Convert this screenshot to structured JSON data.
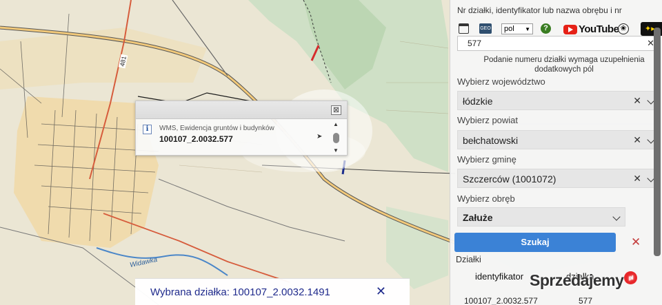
{
  "map": {
    "road_number": "481",
    "place_name": "Widawka"
  },
  "popup": {
    "layer_name": "WMS, Ewidencja gruntów i budynków",
    "parcel_id": "100107_2.0032.577",
    "close_symbol": "⊠",
    "info_symbol": "i"
  },
  "selected_bar": {
    "text": "Wybrana działka: 100107_2.0032.1491",
    "close_symbol": "✕"
  },
  "panel": {
    "top_text": "Nr działki, identyfikator lub nazwa obrębu i nr",
    "toolbar": {
      "geo_label": "GEO",
      "language": "pol",
      "help": "?",
      "youtube": "YouTube",
      "back_symbol": "✦▸"
    },
    "search_value": "577",
    "search_clear": "✕",
    "hint": "Podanie numeru działki wymaga uzupełnienia dodatkowych pól",
    "voivodeship": {
      "label": "Wybierz województwo",
      "value": "łódzkie"
    },
    "county": {
      "label": "Wybierz powiat",
      "value": "bełchatowski"
    },
    "commune": {
      "label": "Wybierz gminę",
      "value": "Szczerców (1001072)"
    },
    "precinct": {
      "label": "Wybierz obręb",
      "value": "Załuże"
    },
    "clear_symbol": "✕",
    "search_button": "Szukaj",
    "cancel_symbol": "✕",
    "results_label": "Działki",
    "table": {
      "headers": [
        "identyfikator",
        "działka"
      ],
      "rows": [
        [
          "100107_2.0032.577",
          "577"
        ]
      ]
    }
  },
  "watermark": {
    "text": "Sprzedajemy",
    "dot": "pl"
  },
  "colors": {
    "accent": "#3b82d6",
    "selected_text": "#1f2a8c",
    "cancel": "#c43c3c"
  }
}
